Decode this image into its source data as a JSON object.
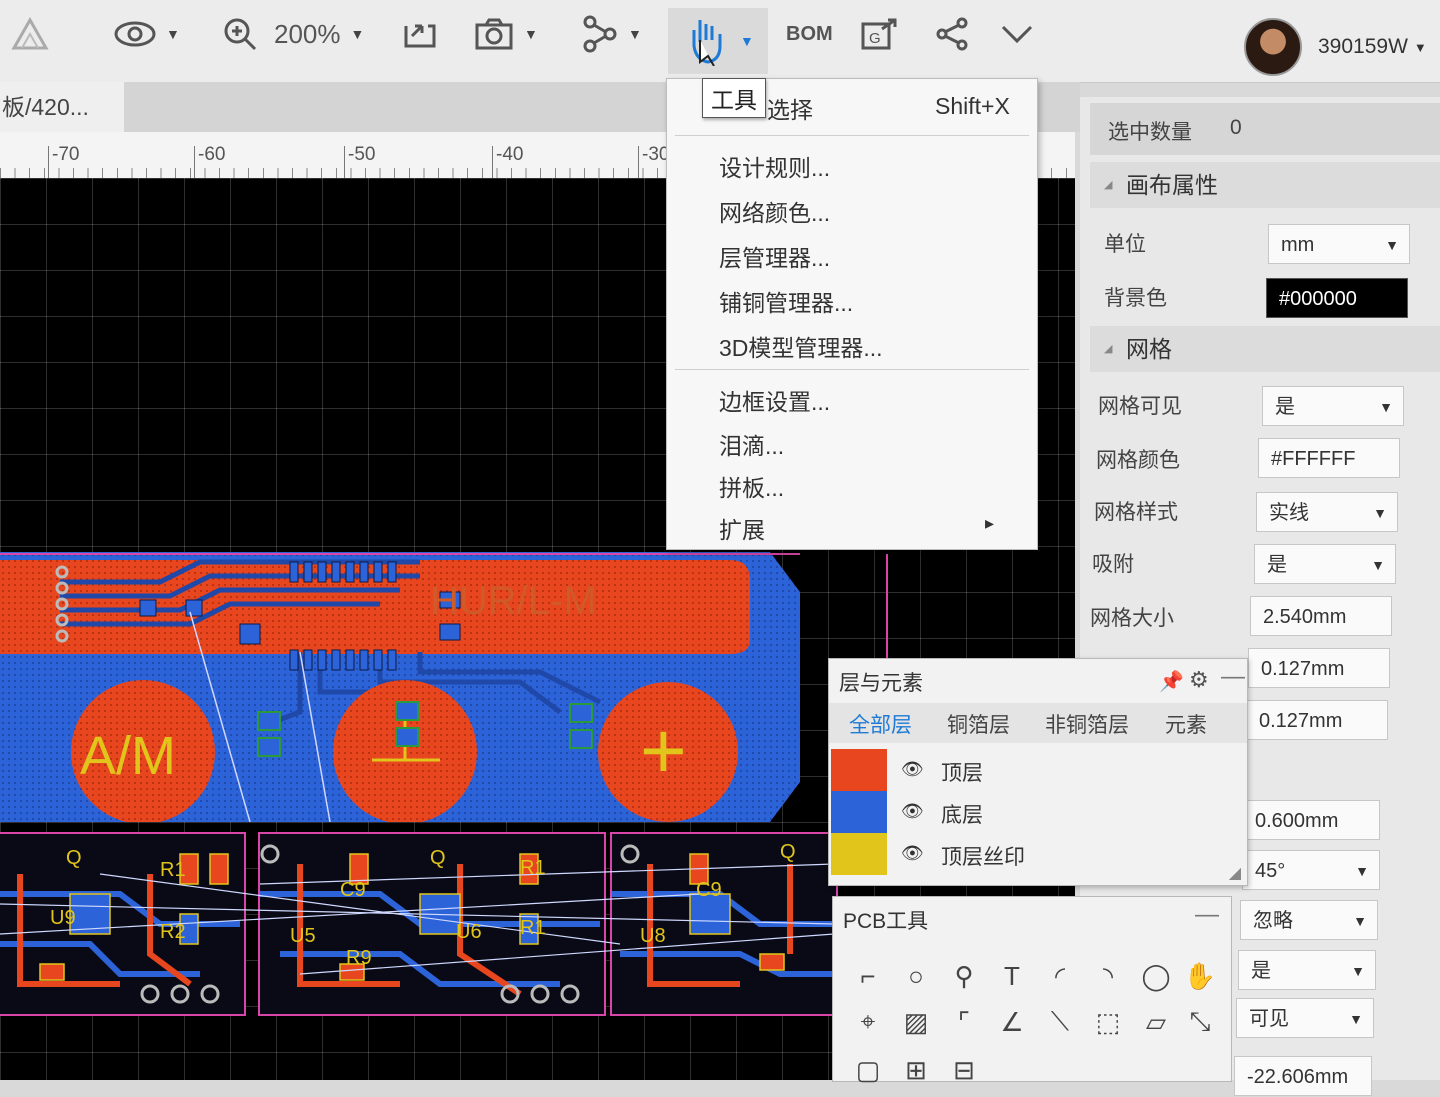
{
  "toolbar": {
    "zoom": "200%",
    "bom": "BOM",
    "user": "390159W"
  },
  "doc_tab": "板/420...",
  "ruler_ticks": [
    "-70",
    "-60",
    "-50",
    "-40",
    "-30"
  ],
  "tooltip": "工具",
  "menu": {
    "first_item": "选择",
    "first_shortcut": "Shift+X",
    "group1": [
      "设计规则...",
      "网络颜色...",
      "层管理器...",
      "铺铜管理器...",
      "3D模型管理器..."
    ],
    "group2": [
      "边框设置...",
      "泪滴...",
      "拼板...",
      "扩展"
    ],
    "submenu_arrow": "▸"
  },
  "props": {
    "selected_label": "选中数量",
    "selected_value": "0",
    "canvas_section": "画布属性",
    "unit_label": "单位",
    "unit_value": "mm",
    "bg_label": "背景色",
    "bg_value": "#000000",
    "grid_section": "网格",
    "grid_visible_label": "网格可见",
    "grid_visible_value": "是",
    "grid_color_label": "网格颜色",
    "grid_color_value": "#FFFFFF",
    "grid_style_label": "网格样式",
    "grid_style_value": "实线",
    "snap_label": "吸附",
    "snap_value": "是",
    "grid_size_label": "网格大小",
    "grid_size_value": "2.540mm",
    "v1": "0.127mm",
    "v2": "0.127mm",
    "v3": "0.600mm",
    "v4": "45°",
    "v5": "忽略",
    "v6": "是",
    "v7": "可见",
    "v8": "-22.606mm"
  },
  "layers_panel": {
    "title": "层与元素",
    "tabs": [
      "全部层",
      "铜箔层",
      "非铜箔层",
      "元素"
    ],
    "rows": [
      {
        "name": "顶层",
        "color": "#e8461e"
      },
      {
        "name": "底层",
        "color": "#2c63d8"
      },
      {
        "name": "顶层丝印",
        "color": "#e2c51b"
      }
    ]
  },
  "tools_panel": {
    "title": "PCB工具"
  },
  "pcb": {
    "board_text": "HUR/L-M",
    "btn1": "A/M",
    "btn3": "+",
    "sub_labels": [
      "Q",
      "R1",
      "U9",
      "R2",
      "Q",
      "R1",
      "C9",
      "U5",
      "R9",
      "Q",
      "U6",
      "C9",
      "U8",
      "R1"
    ]
  },
  "colors": {
    "top": "#e8461e",
    "bottom": "#2c63d8",
    "silk": "#e2c51b",
    "outline": "#d946a8",
    "accent": "#1e7ad6"
  }
}
